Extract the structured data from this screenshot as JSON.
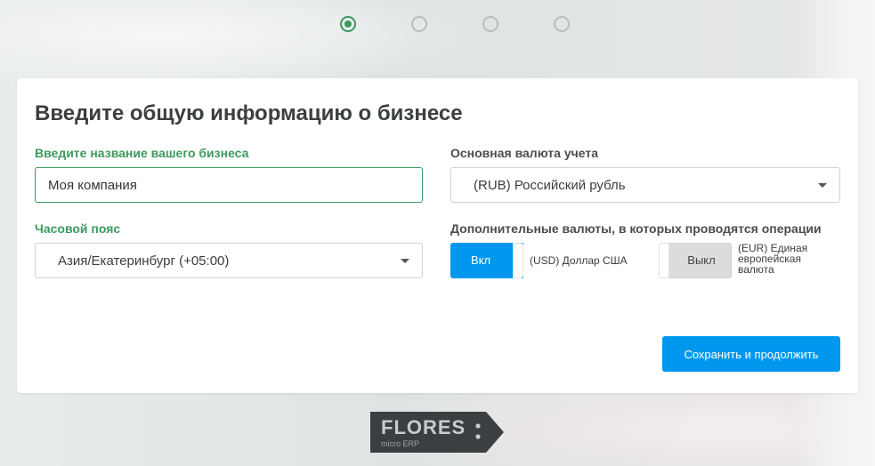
{
  "stepper": {
    "steps": 4,
    "active_index": 0
  },
  "card": {
    "title": "Введите общую информацию о бизнесе",
    "business_name": {
      "label": "Введите название вашего бизнеса",
      "value": "Моя компания"
    },
    "timezone": {
      "label": "Часовой пояс",
      "value": "Азия/Екатеринбург (+05:00)"
    },
    "base_currency": {
      "label": "Основная валюта учета",
      "value": "(RUB) Российский рубль"
    },
    "additional_currencies": {
      "label": "Дополнительные валюты, в которых проводятся операции",
      "items": [
        {
          "toggle_label": "Вкл",
          "state": "on",
          "currency": "(USD) Доллар США"
        },
        {
          "toggle_label": "Выкл",
          "state": "off",
          "currency_line1": "(EUR) Единая",
          "currency_line2": "европейская",
          "currency_line3": "валюта"
        }
      ]
    },
    "save_button": "Сохранить и продолжить"
  },
  "logo": {
    "name": "FLORES",
    "subtitle": "micro ERP"
  },
  "colors": {
    "accent": "#0097ef",
    "green": "#3d9a5d",
    "toggle_off": "#dcdcdc"
  }
}
